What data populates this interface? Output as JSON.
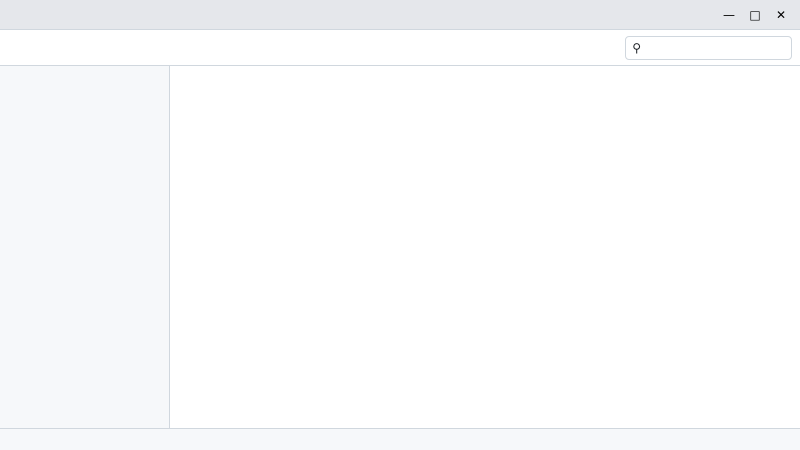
{
  "window": {
    "title": ""
  },
  "toolbar": {
    "buttons": [],
    "search": {
      "value": "",
      "placeholder": ""
    }
  },
  "sidebar": {
    "items": []
  },
  "main": {
    "title": ""
  },
  "statusbar": {
    "text": ""
  }
}
